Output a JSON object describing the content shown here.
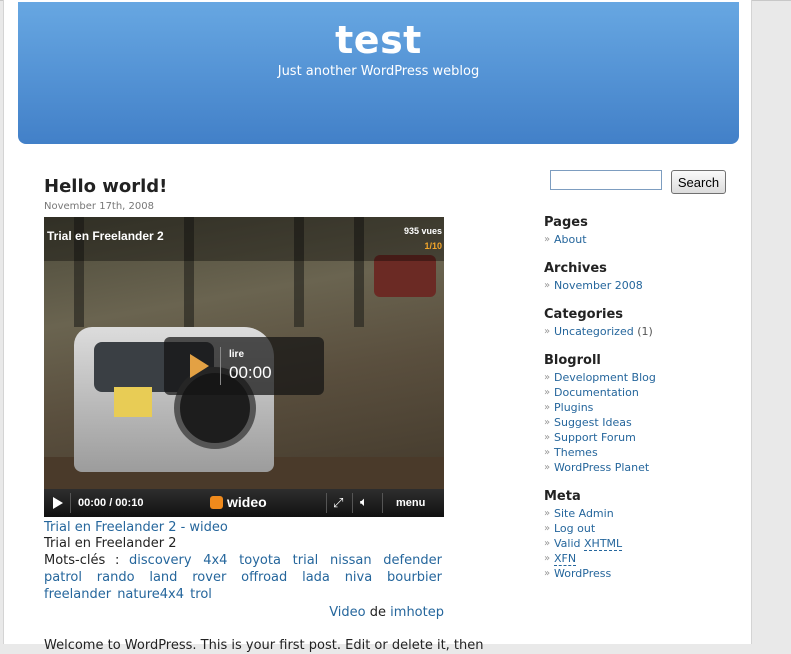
{
  "header": {
    "blog_title": "test",
    "blog_description": "Just another WordPress weblog"
  },
  "post": {
    "title": "Hello world!",
    "date": "November 17th, 2008",
    "video": {
      "title": "Trial en Freelander 2",
      "views": "935 vues",
      "page_counter": "1/10",
      "overlay_label": "lire",
      "overlay_time": "00:00",
      "time_display": "00:00 / 00:10",
      "brand": "wideo",
      "menu_label": "menu"
    },
    "video_link": "Trial en Freelander 2 - wideo",
    "video_subtitle": "Trial en Freelander 2",
    "tags_label": "Mots-clés :",
    "tags": [
      "discovery",
      "4x4",
      "toyota",
      "trial",
      "nissan",
      "defender",
      "patrol",
      "rando",
      "land",
      "rover",
      "offroad",
      "lada",
      "niva",
      "bourbier",
      "freelander",
      "nature4x4",
      "trol"
    ],
    "credit": {
      "video_word": "Video",
      "de_word": "de",
      "author": "imhotep"
    },
    "body_text": "Welcome to WordPress. This is your first post. Edit or delete it, then"
  },
  "sidebar": {
    "search": {
      "input_value": "",
      "button_label": "Search"
    },
    "pages": {
      "title": "Pages",
      "items": [
        "About"
      ]
    },
    "archives": {
      "title": "Archives",
      "items": [
        "November 2008"
      ]
    },
    "categories": {
      "title": "Categories",
      "items": [
        {
          "label": "Uncategorized",
          "count": "(1)"
        }
      ]
    },
    "blogroll": {
      "title": "Blogroll",
      "items": [
        "Development Blog",
        "Documentation",
        "Plugins",
        "Suggest Ideas",
        "Support Forum",
        "Themes",
        "WordPress Planet"
      ]
    },
    "meta": {
      "title": "Meta",
      "items": {
        "site_admin": "Site Admin",
        "log_out": "Log out",
        "valid_word": "Valid",
        "xhtml": "XHTML",
        "xfn": "XFN",
        "wordpress": "WordPress"
      }
    }
  },
  "colors": {
    "header_top": "#67a7e2",
    "header_bottom": "#4280c8",
    "link": "#25669c",
    "accent_orange": "#f08a1c"
  }
}
